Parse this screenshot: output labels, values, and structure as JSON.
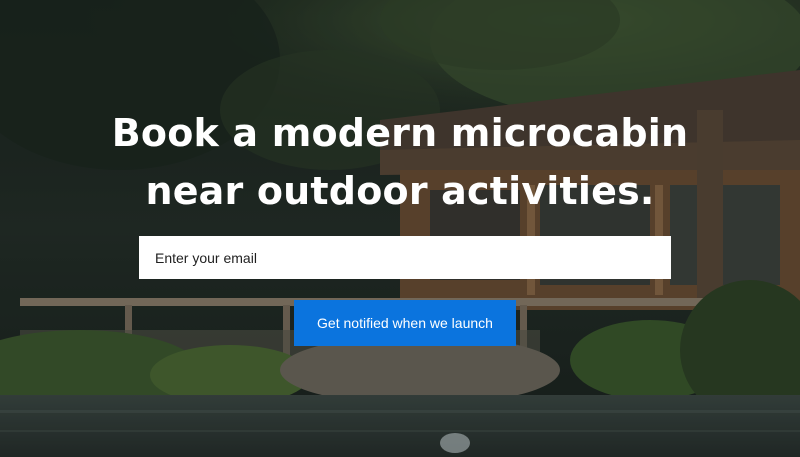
{
  "hero": {
    "headline_line1": "Book a modern microcabin",
    "headline_line2": "near outdoor activities.",
    "background_image": "forest cabin by a lake"
  },
  "signup": {
    "email_placeholder": "Enter your email",
    "email_value": "",
    "button_label": "Get notified when we launch"
  },
  "colors": {
    "button_bg": "#0b74de",
    "headline_text": "#ffffff",
    "input_bg": "#ffffff"
  }
}
